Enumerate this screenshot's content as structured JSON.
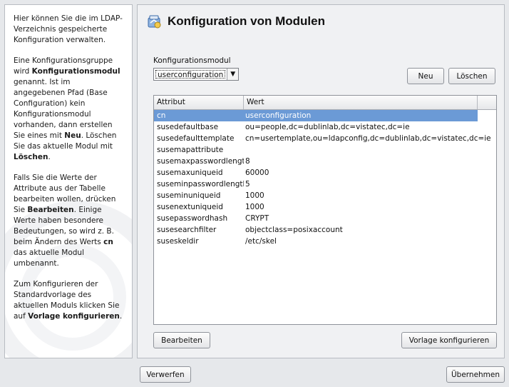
{
  "help": {
    "p1": "Hier können Sie die im LDAP-Verzeichnis gespeicherte Konfiguration verwalten.",
    "p2_a": "Eine Konfigurationsgruppe wird",
    "p2_b": "Konfigurationsmodul",
    "p2_c": "genannt. Ist im angegebenen Pfad (Base Configuration) kein Konfigurationsmodul vorhanden, dann erstellen Sie eines mit",
    "p2_d": "Neu",
    "p2_e": ". Löschen Sie das aktuelle Modul mit",
    "p2_f": "Löschen",
    "p2_g": ".",
    "p3_a": "Falls Sie die Werte der Attribute aus der Tabelle bearbeiten wollen, drücken Sie",
    "p3_b": "Bearbeiten",
    "p3_c": ". Einige Werte haben besondere Bedeutungen, so wird z. B. beim Ändern des Werts",
    "p3_d": "cn",
    "p3_e": "das aktuelle Modul umbenannt.",
    "p4_a": "Zum Konfigurieren der Standardvorlage des aktuellen Moduls klicken Sie auf",
    "p4_b": "Vorlage konfigurieren",
    "p4_c": "."
  },
  "main": {
    "title": "Konfiguration von Modulen",
    "module_label": "Konfigurationsmodul",
    "module_value": "userconfiguration",
    "new_button": "Neu",
    "delete_button": "Löschen",
    "edit_button": "Bearbeiten",
    "template_button": "Vorlage konfigurieren"
  },
  "table": {
    "headers": [
      "Attribut",
      "Wert"
    ],
    "rows": [
      {
        "attr": "cn",
        "value": "userconfiguration"
      },
      {
        "attr": "susedefaultbase",
        "value": "ou=people,dc=dublinlab,dc=vistatec,dc=ie"
      },
      {
        "attr": "susedefaulttemplate",
        "value": "cn=usertemplate,ou=ldapconfig,dc=dublinlab,dc=vistatec,dc=ie"
      },
      {
        "attr": "susemapattribute",
        "value": ""
      },
      {
        "attr": "susemaxpasswordlength",
        "value": "8"
      },
      {
        "attr": "susemaxuniqueid",
        "value": "60000"
      },
      {
        "attr": "suseminpasswordlength",
        "value": "5"
      },
      {
        "attr": "suseminuniqueid",
        "value": "1000"
      },
      {
        "attr": "susenextuniqueid",
        "value": "1000"
      },
      {
        "attr": "susepasswordhash",
        "value": "CRYPT"
      },
      {
        "attr": "susesearchfilter",
        "value": "objectclass=posixaccount"
      },
      {
        "attr": "suseskeldir",
        "value": "/etc/skel"
      }
    ]
  },
  "footer": {
    "discard_button": "Verwerfen",
    "apply_button": "Übernehmen"
  },
  "colors": {
    "selection": "#6b9ad6",
    "background": "#e6e8eb"
  }
}
